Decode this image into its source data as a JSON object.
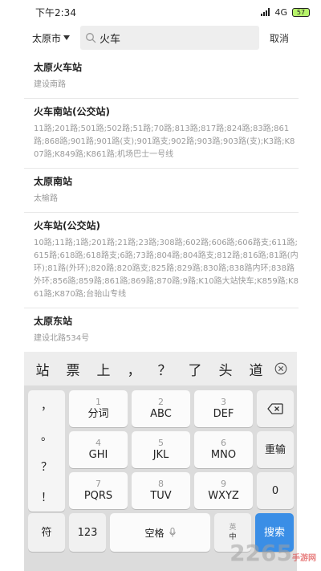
{
  "status_bar": {
    "time": "下午2:34",
    "network": "4G",
    "battery": "57"
  },
  "header": {
    "city": "太原市",
    "query": "火车",
    "cancel_label": "取消"
  },
  "results": [
    {
      "title": "太原火车站",
      "subtitle": "建设南路"
    },
    {
      "title": "火车南站(公交站)",
      "subtitle": "11路;201路;501路;502路;51路;70路;813路;817路;824路;83路;861路;868路;901路;901路(支);901路支;902路;903路;903路(支);K3路;K807路;K849路;K861路;机场巴士一号线"
    },
    {
      "title": "太原南站",
      "subtitle": "太榆路"
    },
    {
      "title": "火车站(公交站)",
      "subtitle": "10路;11路;1路;201路;21路;23路;308路;602路;606路;606路支;611路;615路;618路;618路支;6路;73路;804路;804路支;812路;816路;81路(内环);81路(外环);820路;820路支;825路;829路;830路;838路内环;838路外环;856路;859路;861路;869路;870路;9路;K10路大站快车;K859路;K861路;K870路;台骀山专线"
    },
    {
      "title": "太原东站",
      "subtitle": "建设北路534号"
    }
  ],
  "keyboard": {
    "candidates": [
      "站",
      "票",
      "上",
      "，",
      "？",
      "了",
      "头",
      "道"
    ],
    "punctuation": [
      "，",
      "。",
      "？",
      "！"
    ],
    "keys": {
      "k1": {
        "num": "1",
        "label": "分词"
      },
      "k2": {
        "num": "2",
        "label": "ABC"
      },
      "k3": {
        "num": "3",
        "label": "DEF"
      },
      "k4": {
        "num": "4",
        "label": "GHI"
      },
      "k5": {
        "num": "5",
        "label": "JKL"
      },
      "k6": {
        "num": "6",
        "label": "MNO"
      },
      "k7": {
        "num": "7",
        "label": "PQRS"
      },
      "k8": {
        "num": "8",
        "label": "TUV"
      },
      "k9": {
        "num": "9",
        "label": "WXYZ"
      }
    },
    "reinput_label": "重输",
    "zero_label": "0",
    "symbol_label": "符",
    "digits_label": "123",
    "space_label": "空格",
    "lang_en": "英",
    "lang_zh": "中",
    "search_label": "搜索"
  },
  "watermark": {
    "main": "2265",
    "sub": "手游网"
  },
  "colors": {
    "accent": "#3a8ee6",
    "cursor": "#f08a24"
  }
}
